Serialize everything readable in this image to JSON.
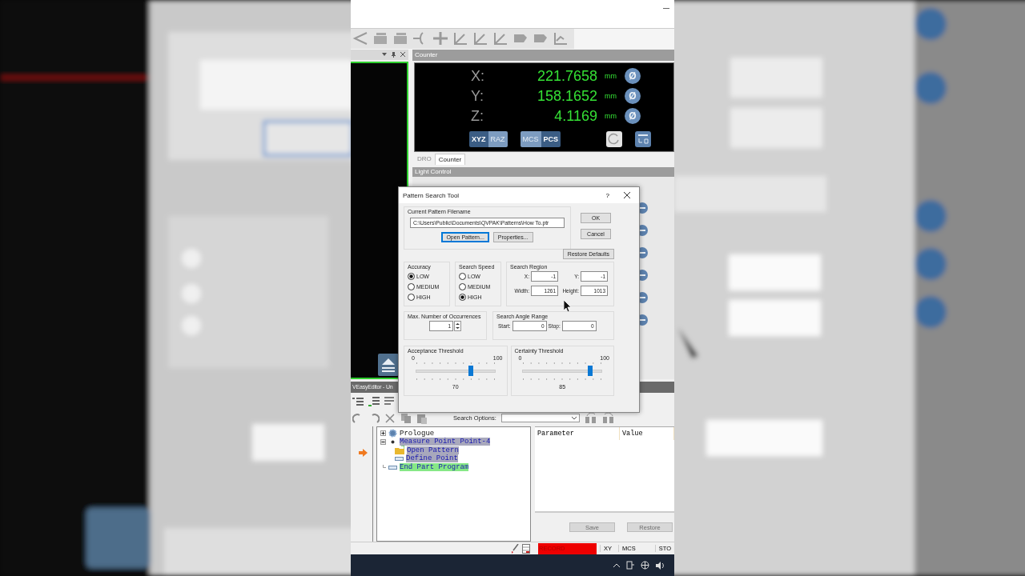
{
  "counter_panel": {
    "title": "Counter",
    "axes": [
      {
        "label": "X:",
        "value": "221.7658",
        "unit": "mm",
        "zero": "Ø"
      },
      {
        "label": "Y:",
        "value": "158.1652",
        "unit": "mm",
        "zero": "Ø"
      },
      {
        "label": "Z:",
        "value": "4.1169",
        "unit": "mm",
        "zero": "Ø"
      }
    ],
    "toggles": [
      [
        {
          "label": "XYZ",
          "selected": true
        },
        {
          "label": "RAZ",
          "selected": false
        }
      ],
      [
        {
          "label": "MCS",
          "selected": false
        },
        {
          "label": "PCS",
          "selected": true
        }
      ]
    ],
    "tabs": [
      {
        "label": "DRO",
        "selected": false
      },
      {
        "label": "Counter",
        "selected": true
      }
    ]
  },
  "light_control": {
    "title": "Light Control"
  },
  "editor": {
    "title": "VEasyEditor - Un",
    "search_label": "Search Options:",
    "tree": [
      {
        "label": "Prologue",
        "kind": "gear",
        "expanded": false
      },
      {
        "label": "Measure Point Point-4",
        "kind": "dot",
        "expanded": true,
        "color": "#a8a8bc",
        "children": [
          {
            "label": "Open Pattern",
            "kind": "folder",
            "color": "#a8a8bc"
          },
          {
            "label": "Define Point",
            "kind": "bar",
            "color": "#a8a8bc"
          }
        ]
      },
      {
        "label": "End Part Program",
        "kind": "bar",
        "color": "#86e886"
      }
    ],
    "columns": [
      "Parameter",
      "Value"
    ],
    "buttons": [
      {
        "label": "Save",
        "disabled": true
      },
      {
        "label": "Restore",
        "disabled": true
      }
    ]
  },
  "status_bar": {
    "record": "RECORD",
    "items": [
      "XY",
      "MCS",
      "STO"
    ]
  },
  "dialog": {
    "title": "Pattern Search Tool",
    "help": "?",
    "filename": {
      "title": "Current Pattern Filename",
      "value": "C:\\Users\\Public\\Documents\\QVPAK\\Patterns\\How To.ptr",
      "buttons": [
        {
          "label": "Open Pattern...",
          "focused": true
        },
        {
          "label": "Properties...",
          "focused": false
        }
      ]
    },
    "buttons": [
      "OK",
      "Cancel"
    ],
    "restore": "Restore Defaults",
    "accuracy": {
      "title": "Accuracy",
      "options": [
        {
          "label": "LOW",
          "selected": true
        },
        {
          "label": "MEDIUM",
          "selected": false
        },
        {
          "label": "HIGH",
          "selected": false
        }
      ]
    },
    "speed": {
      "title": "Search Speed",
      "options": [
        {
          "label": "LOW",
          "selected": false
        },
        {
          "label": "MEDIUM",
          "selected": false
        },
        {
          "label": "HIGH",
          "selected": true
        }
      ]
    },
    "region": {
      "title": "Search Region",
      "fields": [
        {
          "label": "X:",
          "value": "-1"
        },
        {
          "label": "Y:",
          "value": "-1"
        },
        {
          "label": "Width:",
          "value": "1261"
        },
        {
          "label": "Height:",
          "value": "1013"
        }
      ]
    },
    "occurrences": {
      "title": "Max. Number of Occurrences",
      "value": "1"
    },
    "angle": {
      "title": "Search Angle Range",
      "fields": [
        {
          "label": "Start:",
          "value": "0"
        },
        {
          "label": "Stop:",
          "value": "0"
        }
      ]
    },
    "sliders": [
      {
        "title": "Acceptance Threshold",
        "min": "0",
        "max": "100",
        "level": 0.7,
        "reading": "70"
      },
      {
        "title": "Certainty Threshold",
        "min": "0",
        "max": "100",
        "level": 0.85,
        "reading": "85"
      }
    ]
  }
}
